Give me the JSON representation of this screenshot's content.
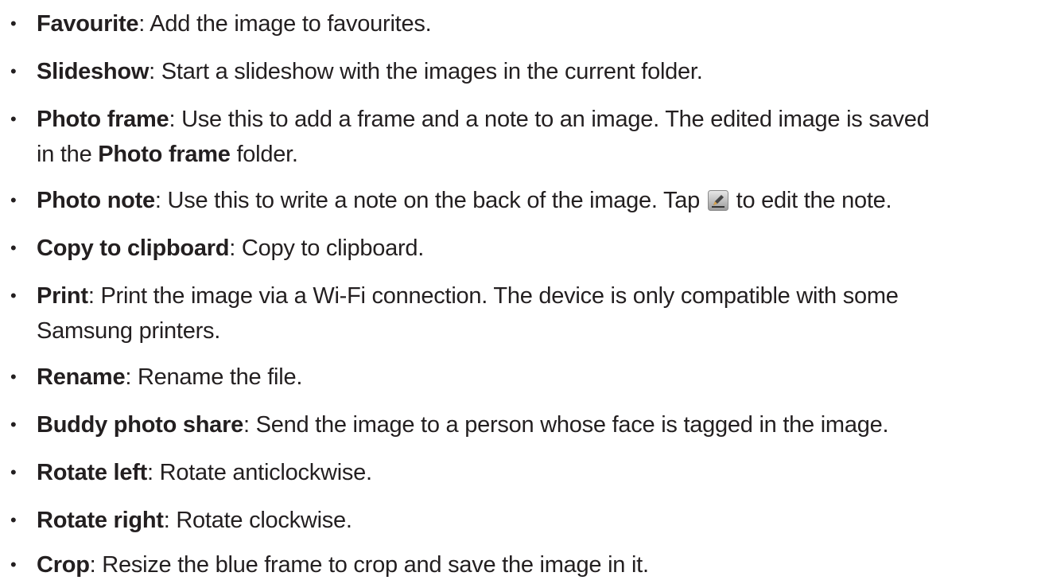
{
  "bullet_glyph": "•",
  "items": [
    {
      "term": "Favourite",
      "sep": ": ",
      "desc": "Add the image to favourites."
    },
    {
      "term": "Slideshow",
      "sep": ": ",
      "desc": "Start a slideshow with the images in the current folder."
    },
    {
      "term": "Photo frame",
      "sep": ": ",
      "desc": "Use this to add a frame and a note to an image. The edited image is saved",
      "desc_line2_prefix": "in the ",
      "desc_line2_term": "Photo frame",
      "desc_line2_suffix": " folder."
    },
    {
      "term": "Photo note",
      "sep": ": ",
      "desc": "Use this to write a note on the back of the image. Tap ",
      "icon": "edit-pencil-icon",
      "desc_after_icon": " to edit the note."
    },
    {
      "term": "Copy to clipboard",
      "sep": ": ",
      "desc": "Copy to clipboard."
    },
    {
      "term": "Print",
      "sep": ": ",
      "desc": "Print the image via a Wi-Fi connection. The device is only compatible with some",
      "desc_line2": "Samsung printers."
    },
    {
      "term": "Rename",
      "sep": ": ",
      "desc": "Rename the file."
    },
    {
      "term": "Buddy photo share",
      "sep": ": ",
      "desc": "Send the image to a person whose face is tagged in the image."
    },
    {
      "term": "Rotate left",
      "sep": ": ",
      "desc": "Rotate anticlockwise."
    },
    {
      "term": "Rotate right",
      "sep": ": ",
      "desc": "Rotate clockwise."
    },
    {
      "term": "Crop",
      "sep": ": ",
      "desc": "Resize the blue frame to crop and save the image in it."
    }
  ]
}
